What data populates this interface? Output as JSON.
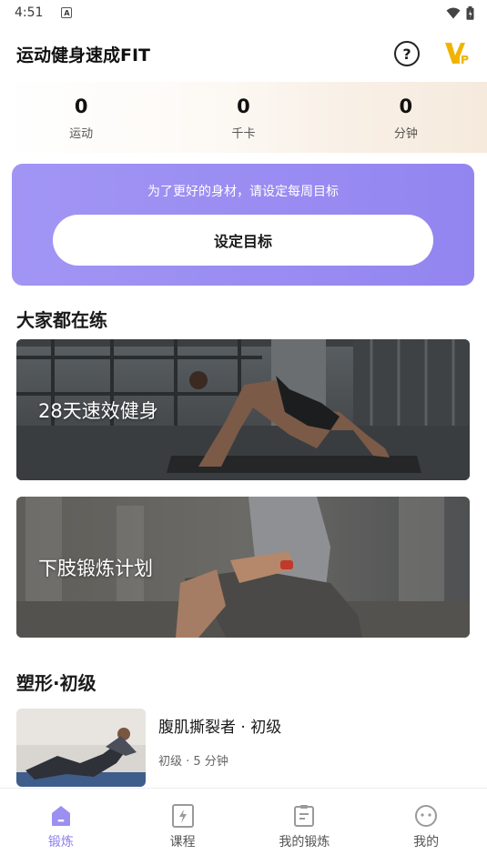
{
  "status_bar": {
    "time": "4:51",
    "badge_letter": "A"
  },
  "header": {
    "title": "运动健身速成FIT",
    "help_symbol": "?"
  },
  "stats": [
    {
      "value": "0",
      "label": "运动"
    },
    {
      "value": "0",
      "label": "千卡"
    },
    {
      "value": "0",
      "label": "分钟"
    }
  ],
  "goal": {
    "prompt": "为了更好的身材，请设定每周目标",
    "button_label": "设定目标"
  },
  "popular": {
    "title": "大家都在练",
    "plans": [
      {
        "label": "28天速效健身"
      },
      {
        "label": "下肢锻炼计划"
      }
    ]
  },
  "shaping": {
    "title": "塑形·初级",
    "course": {
      "title": "腹肌撕裂者 · 初级",
      "meta": "初级 · 5 分钟"
    }
  },
  "nav": [
    {
      "label": "锻炼",
      "icon": "home-icon",
      "active": true
    },
    {
      "label": "课程",
      "icon": "lightning-card-icon",
      "active": false
    },
    {
      "label": "我的锻炼",
      "icon": "clipboard-icon",
      "active": false
    },
    {
      "label": "我的",
      "icon": "face-icon",
      "active": false
    }
  ],
  "colors": {
    "accent": "#8c7ef0",
    "goal_card": "#9a8df2",
    "vip": "#f0b400"
  }
}
